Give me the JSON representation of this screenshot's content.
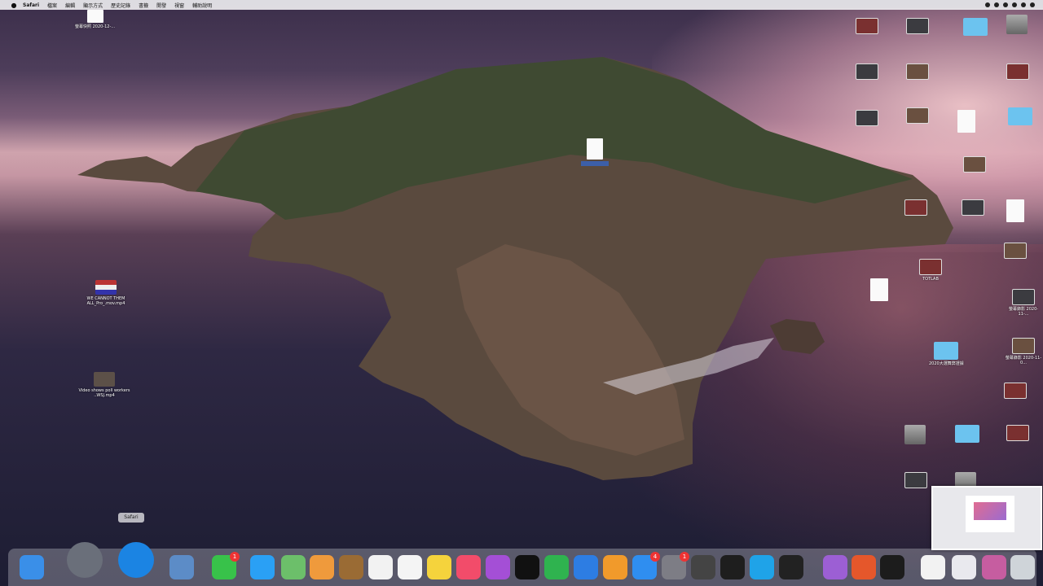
{
  "menubar": {
    "app_name": "Safari",
    "items": [
      "檔案",
      "編輯",
      "顯示方式",
      "歷史記錄",
      "書籤",
      "開發",
      "視窗",
      "輔助說明"
    ]
  },
  "desktop_left_icons": [
    {
      "label": "螢幕快照 2020-12-...",
      "kind": "image"
    },
    {
      "label": "WE CANNOT THEM ALL_Pro_.mov.mp4",
      "kind": "video-flag"
    },
    {
      "label": "Video shows poll workers ..WSJ.mp4",
      "kind": "video"
    }
  ],
  "desktop_center_icon": {
    "label": "",
    "kind": "audio-doc"
  },
  "desktop_right_icons": [
    {
      "label": "",
      "kind": "video"
    },
    {
      "label": "",
      "kind": "video"
    },
    {
      "label": "",
      "kind": "folder"
    },
    {
      "label": "",
      "kind": "drive"
    },
    {
      "label": "",
      "kind": "video"
    },
    {
      "label": "",
      "kind": "video"
    },
    {
      "label": "",
      "kind": "video"
    },
    {
      "label": "",
      "kind": "video"
    },
    {
      "label": "",
      "kind": "video"
    },
    {
      "label": "",
      "kind": "music"
    },
    {
      "label": "",
      "kind": "folder"
    },
    {
      "label": "",
      "kind": "video"
    },
    {
      "label": "",
      "kind": "video"
    },
    {
      "label": "",
      "kind": "video"
    },
    {
      "label": "",
      "kind": "document"
    },
    {
      "label": "TOTLAB",
      "kind": "image"
    },
    {
      "label": "",
      "kind": "document"
    },
    {
      "label": "",
      "kind": "video"
    },
    {
      "label": "2020大選舞弊證據",
      "kind": "folder"
    },
    {
      "label": "螢幕錄影 2020-11-...",
      "kind": "video"
    },
    {
      "label": "螢幕錄影 2020-11-0...",
      "kind": "video"
    },
    {
      "label": "",
      "kind": "video"
    },
    {
      "label": "",
      "kind": "drive"
    },
    {
      "label": "",
      "kind": "folder"
    },
    {
      "label": "",
      "kind": "video"
    },
    {
      "label": "",
      "kind": "video"
    },
    {
      "label": "",
      "kind": "drive"
    }
  ],
  "dock": {
    "tooltip": "Safari",
    "apps": [
      {
        "name": "finder-icon",
        "color": "#3a8fe8"
      },
      {
        "name": "launchpad-icon",
        "color": "#6a6f7a"
      },
      {
        "name": "safari-icon",
        "color": "#1b84e3"
      },
      {
        "name": "preview-icon",
        "color": "#5c8cc7"
      },
      {
        "name": "facetime-icon",
        "color": "#38c24a",
        "badge": "1"
      },
      {
        "name": "messages-icon",
        "color": "#2aa0f5"
      },
      {
        "name": "maps-icon",
        "color": "#6cbf6a"
      },
      {
        "name": "photos-icon",
        "color": "#ef9a3c"
      },
      {
        "name": "notes-brown-icon",
        "color": "#9a6b34"
      },
      {
        "name": "calendar-icon",
        "color": "#f2f2f2"
      },
      {
        "name": "reminders-icon",
        "color": "#f4f4f4"
      },
      {
        "name": "stickies-icon",
        "color": "#f5d33c"
      },
      {
        "name": "music-icon",
        "color": "#f24c6a"
      },
      {
        "name": "podcasts-icon",
        "color": "#a44fd6"
      },
      {
        "name": "appletv-icon",
        "color": "#111111"
      },
      {
        "name": "numbers-icon",
        "color": "#2fb34f"
      },
      {
        "name": "keynote-icon",
        "color": "#2d7de3"
      },
      {
        "name": "pages-icon",
        "color": "#f19a2b"
      },
      {
        "name": "appstore-icon",
        "color": "#2f8ef0",
        "badge": "4"
      },
      {
        "name": "system-preferences-icon",
        "color": "#7d7d85",
        "badge": "1"
      },
      {
        "name": "screenshot-utility-icon",
        "color": "#444444"
      },
      {
        "name": "obs-icon",
        "color": "#1e1e1e"
      },
      {
        "name": "skype-icon",
        "color": "#1fa3e8"
      },
      {
        "name": "final-cut-icon",
        "color": "#222222"
      },
      {
        "name": "cat-app-icon",
        "color": "#9c5fd4"
      },
      {
        "name": "podcast-capture-icon",
        "color": "#e5572b"
      },
      {
        "name": "terminal-icon",
        "color": "#1c1c1c"
      },
      {
        "name": "recent-doc-icon",
        "color": "#f2f2f2"
      },
      {
        "name": "recent-doc-2-icon",
        "color": "#e9e9ee"
      },
      {
        "name": "recent-window-icon",
        "color": "#c65da0"
      },
      {
        "name": "trash-icon",
        "color": "#cfd4d9"
      }
    ]
  }
}
